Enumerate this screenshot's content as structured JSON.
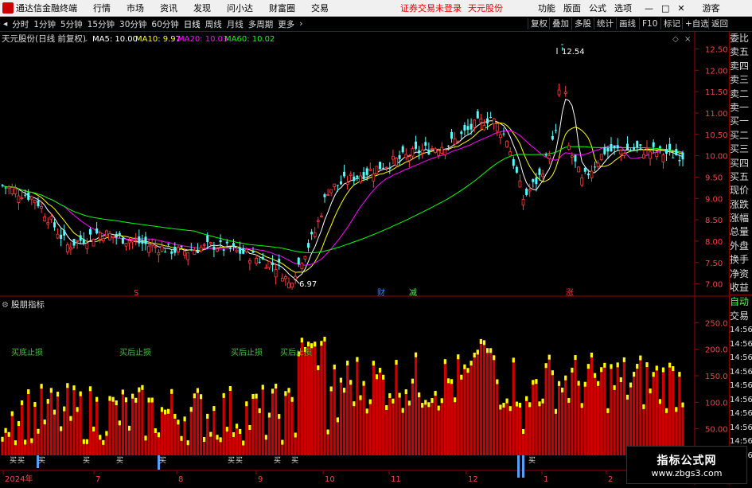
{
  "menubar": {
    "title": "通达信金融终端",
    "menus": [
      "行情",
      "市场",
      "资讯",
      "发现",
      "问小达",
      "财富圈",
      "交易"
    ],
    "status_warning": "证券交易未登录",
    "stock_name": "天元股份",
    "right_menus": [
      "功能",
      "版面",
      "公式",
      "选项"
    ],
    "guest": "游客"
  },
  "toolbar": {
    "periods": [
      "分时",
      "1分钟",
      "5分钟",
      "15分钟",
      "30分钟",
      "60分钟",
      "日线",
      "周线",
      "月线",
      "多周期",
      "更多"
    ],
    "active_period": "日线",
    "right_buttons": [
      "复权",
      "叠加",
      "多股",
      "统计",
      "画线",
      "F10",
      "标记",
      "+自选",
      "返回"
    ]
  },
  "main_chart": {
    "header": "天元股份(日线 前复权)",
    "ma": [
      {
        "label": "MA5: 10.00",
        "color": "#ffffff"
      },
      {
        "label": "MA10: 9.97",
        "color": "#ffff00"
      },
      {
        "label": "MA20: 10.03",
        "color": "#ff00ff"
      },
      {
        "label": "MA60: 10.02",
        "color": "#00ff00"
      }
    ],
    "price_ticks": [
      "12.50",
      "12.00",
      "11.50",
      "11.00",
      "10.50",
      "10.00",
      "9.50",
      "9.00",
      "8.50",
      "8.00",
      "7.50",
      "7.00"
    ],
    "max_label": "12.54",
    "min_label": "6.97",
    "markers": [
      {
        "text": "S",
        "color": "#ff3030"
      },
      {
        "text": "财",
        "color": "#4080ff"
      },
      {
        "text": "减",
        "color": "#40ff40"
      },
      {
        "text": "涨",
        "color": "#ff3030"
      }
    ]
  },
  "sub_chart": {
    "header": "股朋指标",
    "ticks": [
      "250.0",
      "200.0",
      "150.0",
      "100.0",
      "50.00"
    ],
    "labels": [
      "买底止损",
      "买后止损",
      "买后止损",
      "买后止损"
    ],
    "buy_markers": [
      "买",
      "买",
      "买",
      "买",
      "买",
      "买",
      "买",
      "买",
      "买",
      "买",
      "买"
    ]
  },
  "date_axis": [
    "2024年",
    "7",
    "8",
    "9",
    "10",
    "11",
    "12",
    "1",
    "2"
  ],
  "right_panel": {
    "items": [
      "委比",
      "卖五",
      "卖四",
      "卖三",
      "卖二",
      "卖一",
      "买一",
      "买二",
      "买三",
      "买四",
      "买五",
      "现价",
      "涨跌",
      "涨幅",
      "总量",
      "外盘",
      "换手",
      "净资",
      "收益"
    ],
    "mode": "自动",
    "trade": "交易",
    "times": [
      "14:56",
      "14:56",
      "14:56",
      "14:56",
      "14:56",
      "14:56",
      "14:56",
      "14:56",
      "14:56",
      "14:56"
    ]
  },
  "watermark": {
    "title": "指标公式网",
    "url": "www.zbgs3.com"
  },
  "colors": {
    "up": "#ff3c3c",
    "down": "#54fcfc",
    "bar_red": "#cc0000",
    "bar_top": "#ffff00",
    "accent": "#c00000"
  },
  "chart_data": {
    "type": "candlestick",
    "price_ylim": [
      6.75,
      12.75
    ],
    "sub_ylim": [
      0,
      270
    ],
    "x_ticks": [
      "2024年",
      "7",
      "8",
      "9",
      "10",
      "11",
      "12",
      "1",
      "2"
    ],
    "key_points": [
      {
        "label": "6.97",
        "value": 6.97
      },
      {
        "label": "12.54",
        "value": 12.54
      }
    ],
    "ma_last": {
      "MA5": 10.0,
      "MA10": 9.97,
      "MA20": 10.03,
      "MA60": 10.02
    }
  }
}
